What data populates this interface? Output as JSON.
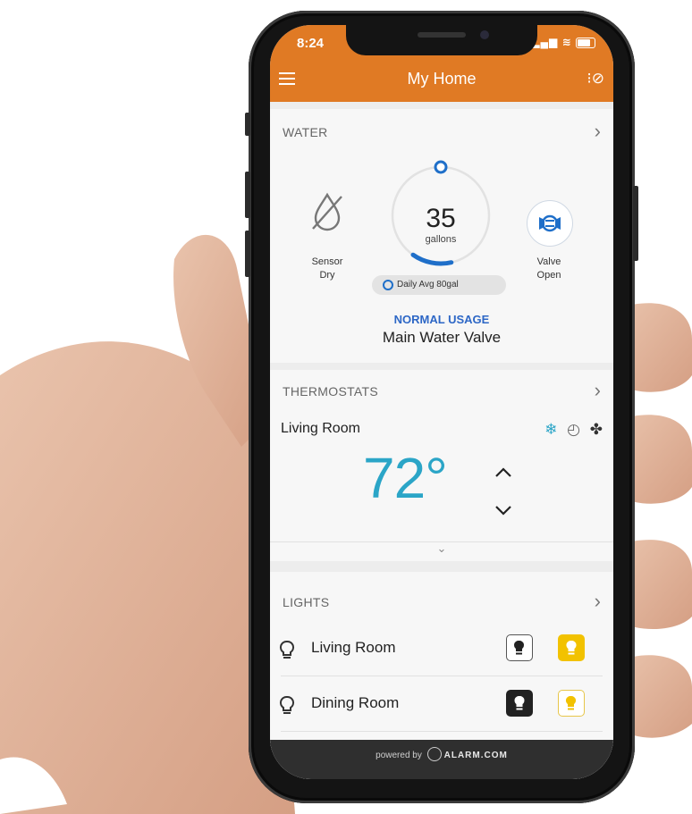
{
  "status_bar": {
    "time": "8:24"
  },
  "header": {
    "title": "My Home",
    "bg_color": "#e07a24"
  },
  "water": {
    "section_title": "WATER",
    "usage_value": "35",
    "usage_unit": "gallons",
    "gauge_fill_fraction": 0.14,
    "sensor_label": "Sensor",
    "sensor_state": "Dry",
    "valve_label": "Valve",
    "valve_state": "Open",
    "daily_avg": "Daily Avg 80gal",
    "usage_status": "NORMAL USAGE",
    "device_name": "Main Water Valve",
    "accent_color": "#2d67c6"
  },
  "thermostats": {
    "section_title": "THERMOSTATS",
    "room": "Living Room",
    "temperature": "72°",
    "temp_color": "#2ba5c7",
    "mode_icons": [
      "snowflake-icon",
      "schedule-icon",
      "fan-icon"
    ]
  },
  "lights": {
    "section_title": "LIGHTS",
    "items": [
      {
        "name": "Living Room",
        "state": "on"
      },
      {
        "name": "Dining Room",
        "state": "off"
      },
      {
        "name": "",
        "state": "off"
      }
    ],
    "on_color": "#f2c200"
  },
  "footer": {
    "powered_by": "powered by",
    "brand": "ALARM.COM"
  }
}
